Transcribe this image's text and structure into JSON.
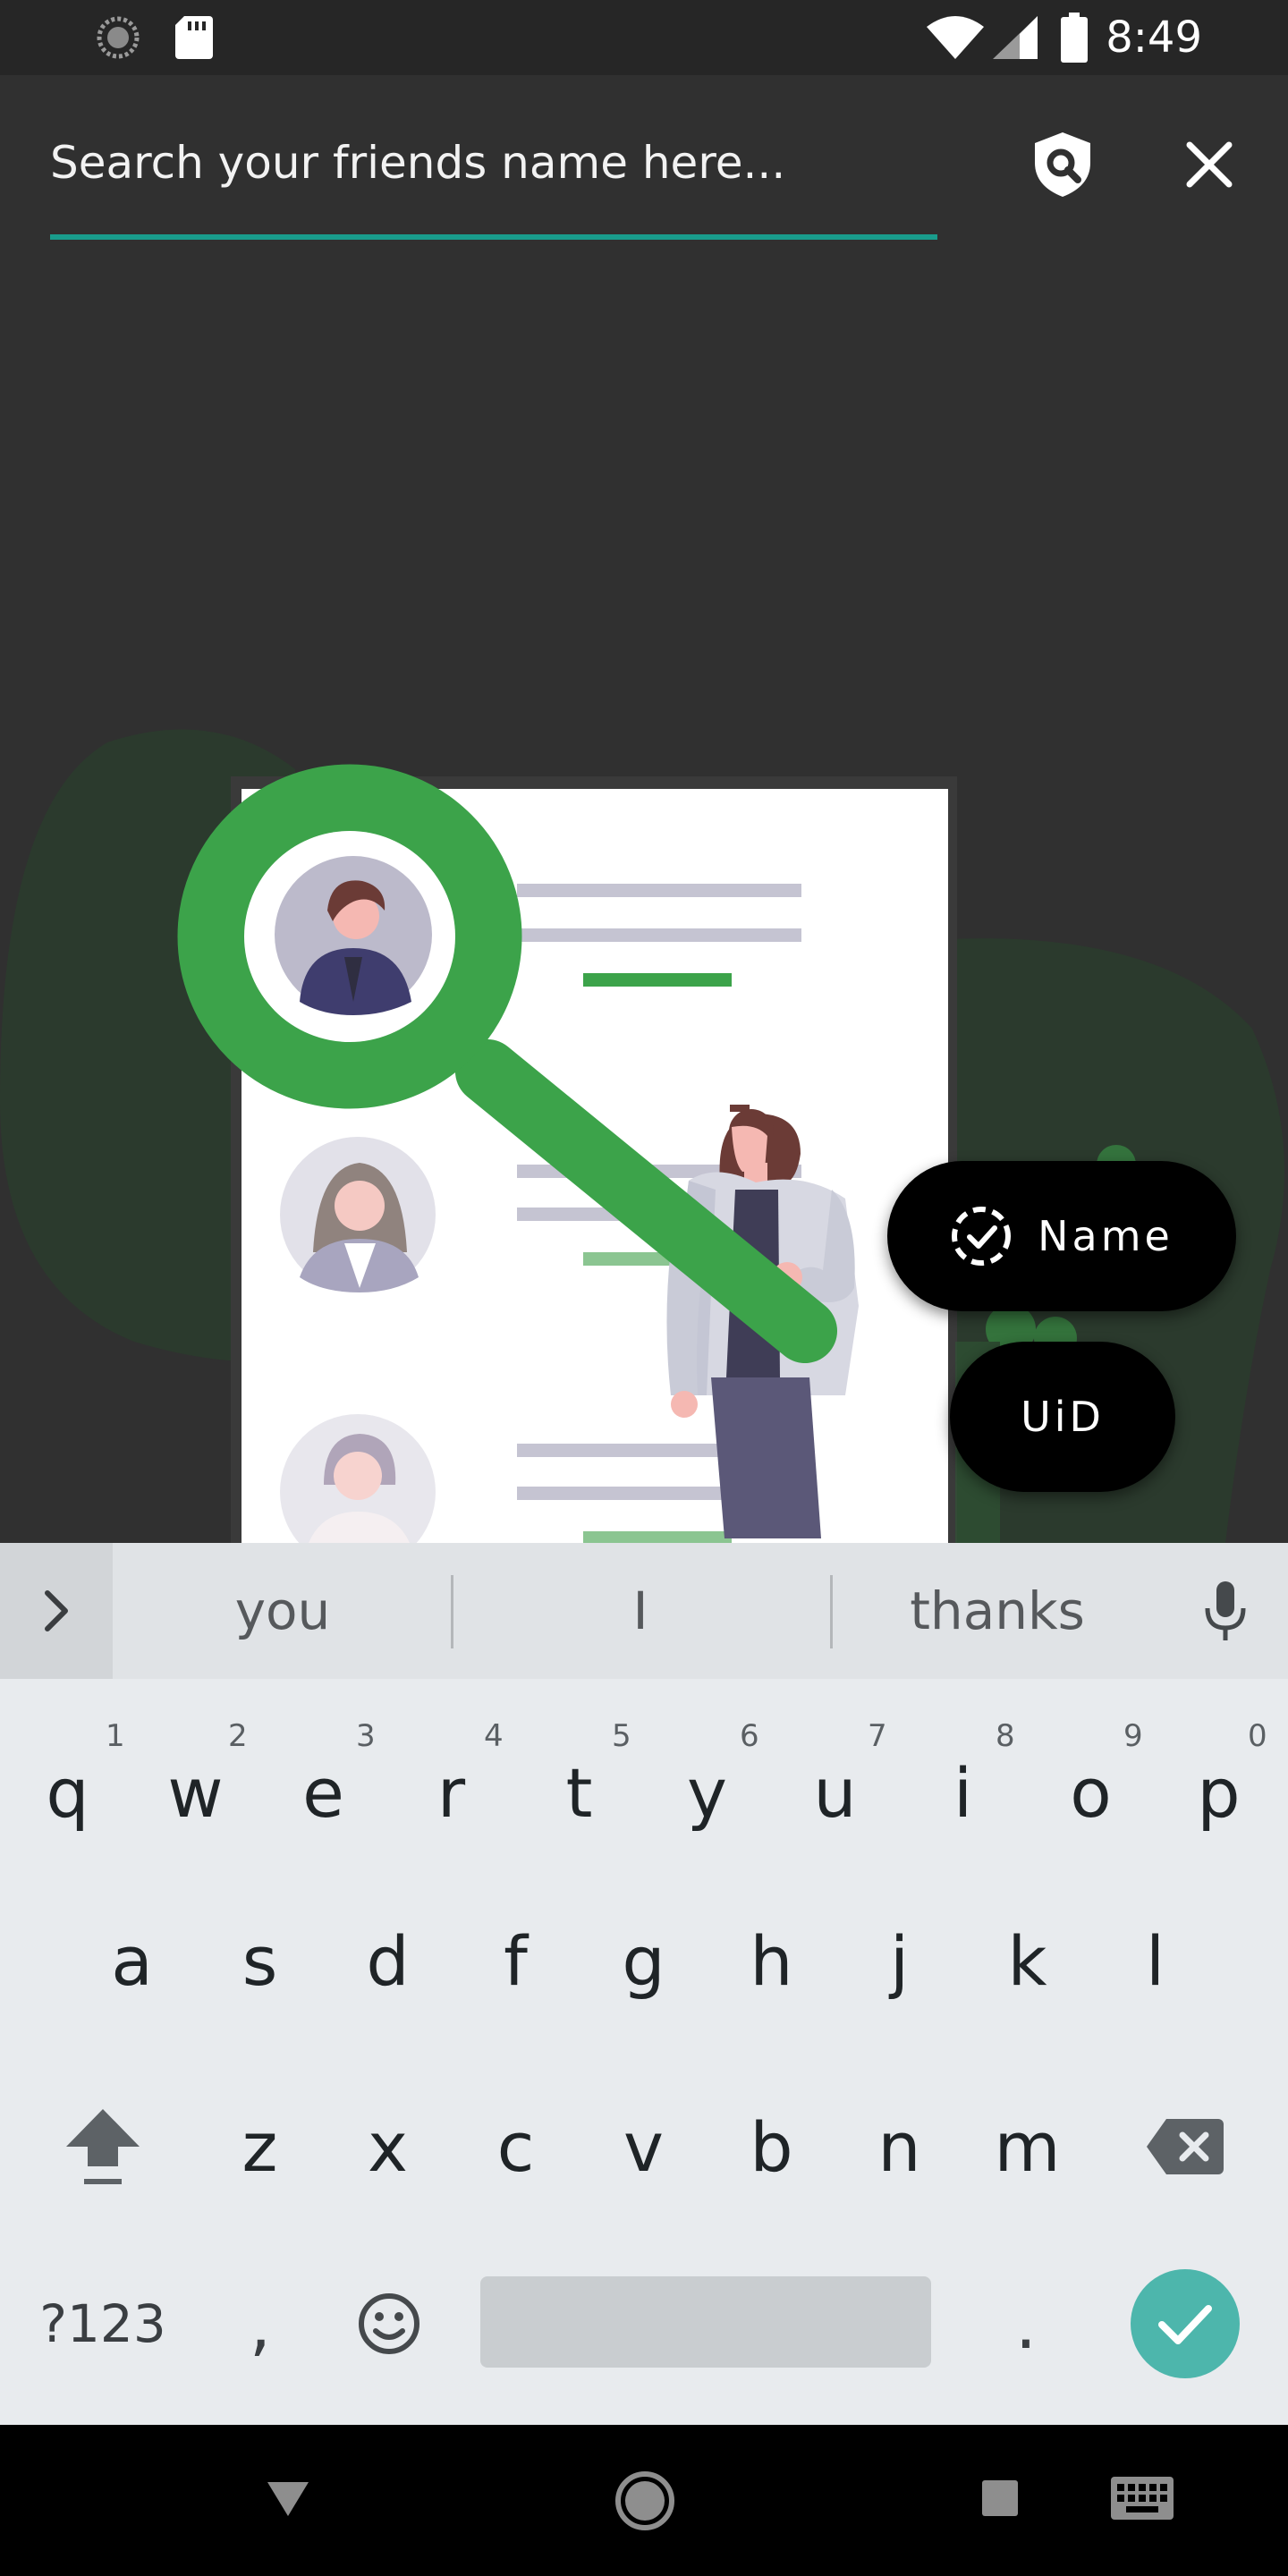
{
  "status_bar": {
    "time": "8:49",
    "icons": [
      "loading-icon",
      "sd-card-icon",
      "wifi-icon",
      "cellular-signal-icon",
      "battery-icon"
    ]
  },
  "search": {
    "placeholder": "Search your friends name here...",
    "value": "",
    "underline_color": "#199c8c"
  },
  "toolbar": {
    "actions": [
      "search-shield-icon",
      "close-icon"
    ]
  },
  "fabs": {
    "name_label": "Name",
    "uid_label": "UiD"
  },
  "keyboard": {
    "suggestions": [
      "you",
      "I",
      "thanks"
    ],
    "row1": [
      {
        "key": "q",
        "hint": "1"
      },
      {
        "key": "w",
        "hint": "2"
      },
      {
        "key": "e",
        "hint": "3"
      },
      {
        "key": "r",
        "hint": "4"
      },
      {
        "key": "t",
        "hint": "5"
      },
      {
        "key": "y",
        "hint": "6"
      },
      {
        "key": "u",
        "hint": "7"
      },
      {
        "key": "i",
        "hint": "8"
      },
      {
        "key": "o",
        "hint": "9"
      },
      {
        "key": "p",
        "hint": "0"
      }
    ],
    "row2": [
      "a",
      "s",
      "d",
      "f",
      "g",
      "h",
      "j",
      "k",
      "l"
    ],
    "row3": [
      "z",
      "x",
      "c",
      "v",
      "b",
      "n",
      "m"
    ],
    "symbols_label": "?123",
    "comma": ",",
    "period": ".",
    "accent_color": "#4db6ac"
  },
  "nav_bar": {
    "icons": [
      "back-icon",
      "home-icon",
      "recents-icon",
      "keyboard-switch-icon"
    ]
  },
  "colors": {
    "background": "#303030",
    "accent_green": "#3ca34a"
  }
}
